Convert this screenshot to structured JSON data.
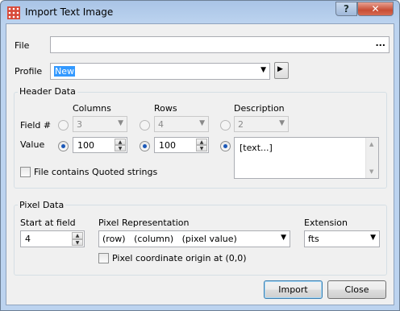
{
  "window": {
    "title": "Import Text Image",
    "help_label": "?",
    "close_label": "✕"
  },
  "file": {
    "label": "File",
    "value": "",
    "browse_label": "..."
  },
  "profile": {
    "label": "Profile",
    "value": "New",
    "arrow": "▼",
    "action_glyph": "▶"
  },
  "header_data": {
    "title": "Header Data",
    "columns_label": "Columns",
    "rows_label": "Rows",
    "description_label": "Description",
    "field_label": "Field #",
    "value_label": "Value",
    "columns_field": "3",
    "rows_field": "4",
    "description_field": "2",
    "columns_value": "100",
    "rows_value": "100",
    "description_value": "[text...]",
    "quoted_label": "File contains Quoted strings"
  },
  "pixel_data": {
    "title": "Pixel Data",
    "start_label": "Start at field",
    "start_value": "4",
    "representation_label": "Pixel Representation",
    "representation_value": "(row)   (column)   (pixel value)",
    "extension_label": "Extension",
    "extension_value": "fts",
    "origin_label": "Pixel coordinate origin at (0,0)"
  },
  "buttons": {
    "import_label": "Import",
    "close_label": "Close"
  },
  "colors": {
    "titlebar": "#a9c4e6",
    "dialog_bg": "#f0f0f0",
    "selection": "#3399ff",
    "radio_dot": "#1b58b8",
    "close_btn": "#c84d34"
  }
}
